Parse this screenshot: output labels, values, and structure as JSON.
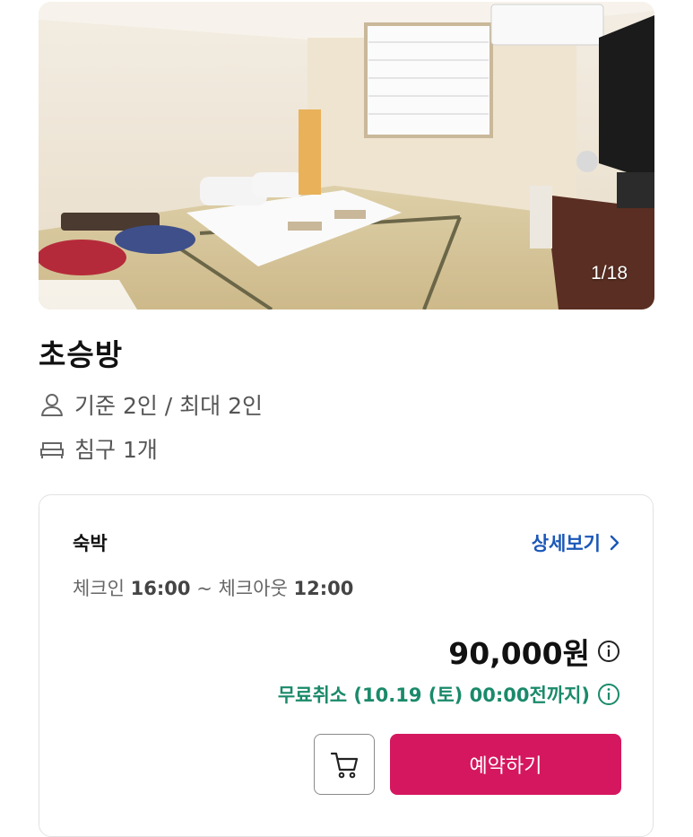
{
  "gallery": {
    "counter": "1/18"
  },
  "room": {
    "name": "초승방",
    "capacity": "기준 2인 / 최대 2인",
    "bed": "침구 1개",
    "capacity_icon": "person-icon",
    "bed_icon": "bed-icon"
  },
  "stay": {
    "label": "숙박",
    "detail_link": "상세보기",
    "checkin_label": "체크인",
    "checkin_time": "16:00",
    "separator": "~",
    "checkout_label": "체크아웃",
    "checkout_time": "12:00",
    "price": "90,000원",
    "cancel_text": "무료취소 (10.19 (토) 00:00전까지)",
    "book_label": "예약하기"
  },
  "colors": {
    "link": "#1b57b8",
    "cancel": "#1a8a6a",
    "book_button": "#d5175f"
  }
}
